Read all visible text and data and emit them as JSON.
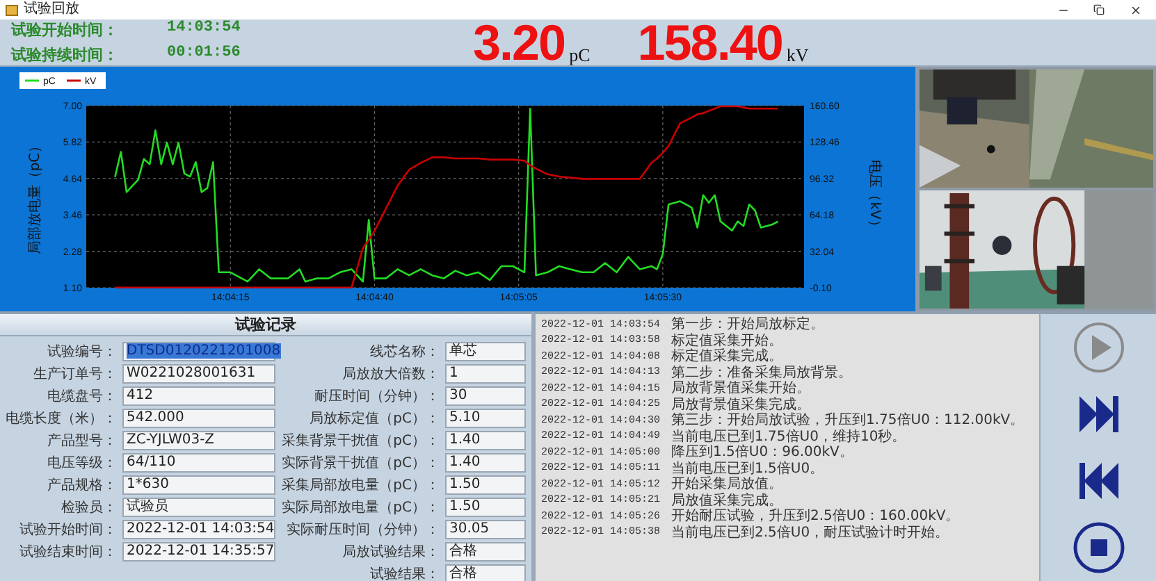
{
  "window": {
    "title": "试验回放"
  },
  "header": {
    "fields": [
      {
        "label": "试验开始时间：",
        "value": "14:03:54"
      },
      {
        "label": "试验持续时间：",
        "value": "00:01:56"
      }
    ],
    "readings": [
      {
        "value": "3.20",
        "unit": "pC"
      },
      {
        "value": "158.40",
        "unit": "kV"
      }
    ]
  },
  "chart": {
    "chart_data": {
      "type": "line",
      "ylabel": "局部放电量（pC）",
      "y2label": "电压（kV）",
      "x": [
        50635,
        50636,
        50637,
        50639,
        50640,
        50641,
        50642,
        50643,
        50644,
        50645,
        50646,
        50647,
        50648,
        50649,
        50650,
        50651,
        50652,
        50653,
        50655,
        50658,
        50660,
        50662,
        50665,
        50667,
        50668,
        50670,
        50672,
        50674,
        50676,
        50678,
        50679,
        50680,
        50682,
        50684,
        50686,
        50688,
        50690,
        50692,
        50694,
        50696,
        50698,
        50700,
        50702,
        50704,
        50706,
        50707,
        50708,
        50710,
        50712,
        50714,
        50716,
        50718,
        50720,
        50722,
        50724,
        50726,
        50728,
        50729,
        50730,
        50731,
        50733,
        50735,
        50736,
        50737,
        50738,
        50739,
        50740,
        50742,
        50743,
        50744,
        50745,
        50746,
        50747,
        50749,
        50750
      ],
      "series": [
        {
          "name": "pC",
          "color": "#22dd22",
          "values": [
            4.69,
            5.5,
            4.2,
            4.6,
            5.27,
            5.1,
            6.2,
            5.1,
            5.8,
            5.1,
            5.8,
            4.8,
            4.7,
            5.17,
            4.2,
            4.33,
            5.17,
            1.6,
            1.6,
            1.3,
            1.7,
            1.4,
            1.4,
            1.7,
            1.3,
            1.4,
            1.4,
            1.6,
            1.7,
            1.3,
            3.3,
            1.4,
            1.4,
            1.7,
            1.5,
            1.7,
            1.5,
            1.4,
            1.65,
            1.5,
            1.6,
            1.35,
            1.8,
            1.8,
            1.6,
            6.9,
            1.5,
            1.6,
            1.8,
            1.7,
            1.6,
            1.6,
            1.9,
            1.6,
            2.1,
            1.7,
            1.8,
            1.7,
            2.2,
            3.8,
            3.9,
            3.7,
            3.05,
            4.1,
            3.85,
            4.1,
            3.25,
            2.95,
            3.25,
            3.1,
            3.8,
            3.6,
            3.05,
            3.15,
            3.25
          ]
        },
        {
          "name": "kV",
          "color": "#cc0000",
          "axis": "y2",
          "values": [
            0,
            0,
            0,
            0,
            0,
            0,
            0,
            0,
            0,
            0,
            0,
            0,
            0,
            0,
            0,
            0,
            0,
            0,
            0,
            0,
            0,
            0,
            0,
            0,
            0,
            0,
            0,
            0,
            0,
            35,
            42,
            50,
            70,
            90,
            104,
            110,
            115,
            115,
            114,
            114,
            114,
            113,
            113,
            113,
            112,
            108,
            105,
            100,
            98,
            97,
            96,
            96,
            96,
            96,
            96,
            96,
            110,
            114,
            119,
            125,
            145,
            150,
            153,
            154,
            156,
            158,
            160,
            160,
            160,
            159,
            158,
            158,
            158,
            158,
            158
          ]
        }
      ],
      "grid": true,
      "legend": "top-left",
      "xlim": [
        50630,
        50754.5
      ],
      "ylim": [
        1.1,
        7.0
      ],
      "y2lim": [
        -0.1,
        160.6
      ],
      "xticks": [
        {
          "value": 50655,
          "label": "14:04:15"
        },
        {
          "value": 50680,
          "label": "14:04:40"
        },
        {
          "value": 50705,
          "label": "14:05:05"
        },
        {
          "value": 50730,
          "label": "14:05:30"
        }
      ],
      "yticks": [
        {
          "value": 1.1,
          "label": "1.10"
        },
        {
          "value": 2.28,
          "label": "2.28"
        },
        {
          "value": 3.46,
          "label": "3.46"
        },
        {
          "value": 4.64,
          "label": "4.64"
        },
        {
          "value": 5.82,
          "label": "5.82"
        },
        {
          "value": 7.0,
          "label": "7.00"
        }
      ],
      "y2ticks": [
        {
          "value": -0.1,
          "label": "-0.10"
        },
        {
          "value": 32.04,
          "label": "32.04"
        },
        {
          "value": 64.18,
          "label": "64.18"
        },
        {
          "value": 96.32,
          "label": "96.32"
        },
        {
          "value": 128.46,
          "label": "128.46"
        },
        {
          "value": 160.6,
          "label": "160.60"
        }
      ]
    }
  },
  "record": {
    "title": "试验记录",
    "rows": [
      {
        "left": {
          "label": "试验编号：",
          "value": "DTSD0120221201008",
          "text_selected": true
        },
        "right": {
          "label": "线芯名称：",
          "value": "单芯"
        }
      },
      {
        "left": {
          "label": "生产订单号：",
          "value": "W0221028001631",
          "text_selected": false
        },
        "right": {
          "label": "局放放大倍数：",
          "value": "1"
        }
      },
      {
        "left": {
          "label": "电缆盘号：",
          "value": "412",
          "text_selected": false
        },
        "right": {
          "label": "耐压时间（分钟）：",
          "value": "30"
        }
      },
      {
        "left": {
          "label": "电缆长度（米）：",
          "value": "542.000",
          "text_selected": false
        },
        "right": {
          "label": "局放标定值（pC）：",
          "value": "5.10"
        }
      },
      {
        "left": {
          "label": "产品型号：",
          "value": "ZC-YJLW03-Z",
          "text_selected": false
        },
        "right": {
          "label": "采集背景干扰值（pC）：",
          "value": "1.40"
        }
      },
      {
        "left": {
          "label": "电压等级：",
          "value": "64/110",
          "text_selected": false
        },
        "right": {
          "label": "实际背景干扰值（pC）：",
          "value": "1.40"
        }
      },
      {
        "left": {
          "label": "产品规格：",
          "value": "1*630",
          "text_selected": false
        },
        "right": {
          "label": "采集局部放电量（pC）：",
          "value": "1.50"
        }
      },
      {
        "left": {
          "label": "检验员：",
          "value": "试验员",
          "text_selected": false
        },
        "right": {
          "label": "实际局部放电量（pC）：",
          "value": "1.50"
        }
      },
      {
        "left": {
          "label": "试验开始时间：",
          "value": "2022-12-01 14:03:54",
          "text_selected": false
        },
        "right": {
          "label": "实际耐压时间（分钟）：",
          "value": "30.05"
        }
      },
      {
        "left": {
          "label": "试验结束时间：",
          "value": "2022-12-01 14:35:57",
          "text_selected": false
        },
        "right": {
          "label": "局放试验结果：",
          "value": "合格"
        }
      },
      {
        "right": {
          "label": "试验结果：",
          "value": "合格"
        }
      }
    ]
  },
  "log": [
    {
      "time": "2022-12-01 14:03:54",
      "message": "第一步：开始局放标定。"
    },
    {
      "time": "2022-12-01 14:03:58",
      "message": "标定值采集开始。"
    },
    {
      "time": "2022-12-01 14:04:08",
      "message": "标定值采集完成。"
    },
    {
      "time": "2022-12-01 14:04:13",
      "message": "第二步：准备采集局放背景。"
    },
    {
      "time": "2022-12-01 14:04:15",
      "message": "局放背景值采集开始。"
    },
    {
      "time": "2022-12-01 14:04:25",
      "message": "局放背景值采集完成。"
    },
    {
      "time": "2022-12-01 14:04:30",
      "message": "第三步：开始局放试验，升压到1.75倍U0：112.00kV。"
    },
    {
      "time": "2022-12-01 14:04:49",
      "message": "当前电压已到1.75倍U0，维持10秒。"
    },
    {
      "time": "2022-12-01 14:05:00",
      "message": "降压到1.5倍U0：96.00kV。"
    },
    {
      "time": "2022-12-01 14:05:11",
      "message": "当前电压已到1.5倍U0。"
    },
    {
      "time": "2022-12-01 14:05:12",
      "message": "开始采集局放值。"
    },
    {
      "time": "2022-12-01 14:05:21",
      "message": "局放值采集完成。"
    },
    {
      "time": "2022-12-01 14:05:26",
      "message": "开始耐压试验，升压到2.5倍U0：160.00kV。"
    },
    {
      "time": "2022-12-01 14:05:38",
      "message": "当前电压已到2.5倍U0，耐压试验计时开始。"
    }
  ],
  "controls": [
    {
      "kind": "play",
      "disabled": true
    },
    {
      "kind": "next",
      "disabled": false
    },
    {
      "kind": "previous",
      "disabled": false
    },
    {
      "kind": "stop",
      "disabled": false
    }
  ]
}
